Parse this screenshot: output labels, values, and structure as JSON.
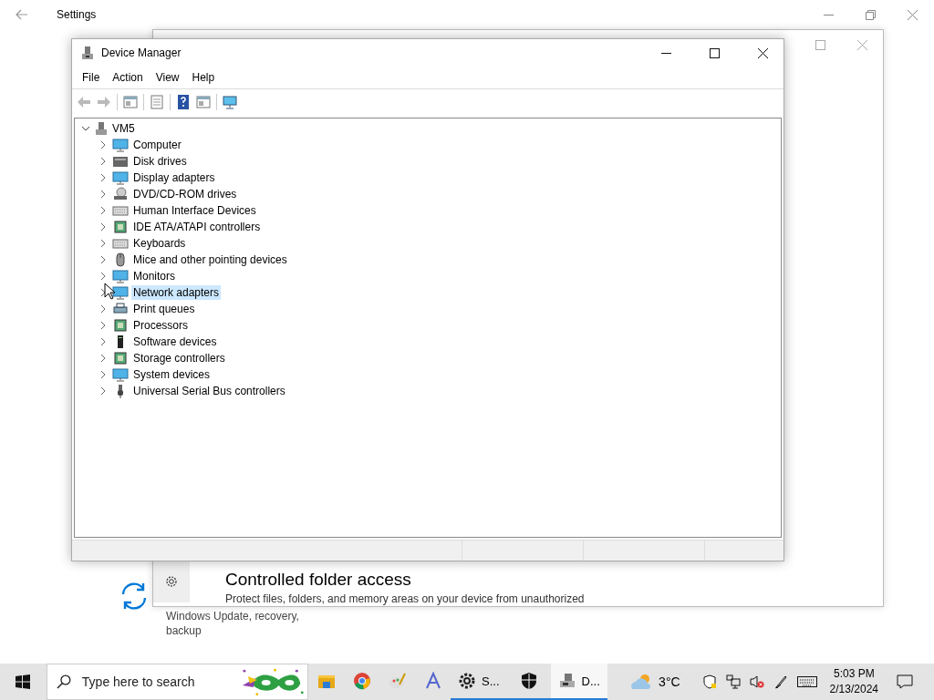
{
  "settings": {
    "title": "Settings",
    "nav_item": {
      "label": "Windows Update, recovery, backup"
    }
  },
  "security_window": {
    "item": {
      "title": "Controlled folder access",
      "description": "Protect files, folders, and memory areas on your device from unauthorized"
    }
  },
  "device_manager": {
    "title": "Device Manager",
    "menu": [
      "File",
      "Action",
      "View",
      "Help"
    ],
    "toolbar": [
      {
        "disabled": true
      },
      {
        "disabled": true
      },
      {
        "disabled": false
      },
      {
        "disabled": false
      },
      {
        "disabled": false
      },
      {
        "disabled": false
      },
      {
        "disabled": false
      }
    ],
    "tree": {
      "label": "VM5",
      "expanded": true,
      "children": [
        {
          "label": "Computer",
          "selected": false
        },
        {
          "label": "Disk drives",
          "selected": false
        },
        {
          "label": "Display adapters",
          "selected": false
        },
        {
          "label": "DVD/CD-ROM drives",
          "selected": false
        },
        {
          "label": "Human Interface Devices",
          "selected": false
        },
        {
          "label": "IDE ATA/ATAPI controllers",
          "selected": false
        },
        {
          "label": "Keyboards",
          "selected": false
        },
        {
          "label": "Mice and other pointing devices",
          "selected": false
        },
        {
          "label": "Monitors",
          "selected": false
        },
        {
          "label": "Network adapters",
          "selected": true
        },
        {
          "label": "Print queues",
          "selected": false
        },
        {
          "label": "Processors",
          "selected": false
        },
        {
          "label": "Software devices",
          "selected": false
        },
        {
          "label": "Storage controllers",
          "selected": false
        },
        {
          "label": "System devices",
          "selected": false
        },
        {
          "label": "Universal Serial Bus controllers",
          "selected": false
        }
      ]
    }
  },
  "taskbar": {
    "search": {
      "placeholder": "Type here to search"
    },
    "apps": [
      {
        "running": false,
        "active": false
      },
      {
        "running": false,
        "active": false
      },
      {
        "running": false,
        "active": false
      },
      {
        "running": false,
        "active": false
      },
      {
        "label": "S...",
        "running": true,
        "active": false
      },
      {
        "running": true,
        "active": false
      },
      {
        "label": "D...",
        "running": true,
        "active": true
      }
    ],
    "weather": "3°C",
    "time": "5:03 PM",
    "date": "2/13/2024"
  }
}
